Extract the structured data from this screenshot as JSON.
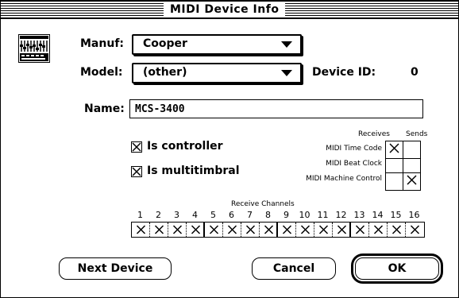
{
  "window": {
    "title": "MIDI Device Info"
  },
  "form": {
    "manuf_label": "Manuf:",
    "manuf_value": "Cooper",
    "model_label": "Model:",
    "model_value": "(other)",
    "device_id_label": "Device ID:",
    "device_id_value": "0",
    "name_label": "Name:",
    "name_value": "MCS-3400"
  },
  "options": {
    "is_controller_label": "Is controller",
    "is_controller_checked": true,
    "is_multitimbral_label": "Is multitimbral",
    "is_multitimbral_checked": true
  },
  "sync": {
    "receives_header": "Receives",
    "sends_header": "Sends",
    "rows": [
      {
        "label": "MIDI Time Code",
        "receives": true,
        "sends": false
      },
      {
        "label": "MIDI Beat Clock",
        "receives": false,
        "sends": false
      },
      {
        "label": "MIDI Machine Control",
        "receives": false,
        "sends": true
      }
    ]
  },
  "channels": {
    "title": "Receive Channels",
    "numbers": [
      "1",
      "2",
      "3",
      "4",
      "5",
      "6",
      "7",
      "8",
      "9",
      "10",
      "11",
      "12",
      "13",
      "14",
      "15",
      "16"
    ],
    "checked": [
      true,
      true,
      true,
      true,
      true,
      true,
      true,
      true,
      true,
      true,
      true,
      true,
      true,
      true,
      true,
      true
    ]
  },
  "buttons": {
    "next_device": "Next Device",
    "cancel": "Cancel",
    "ok": "OK"
  }
}
